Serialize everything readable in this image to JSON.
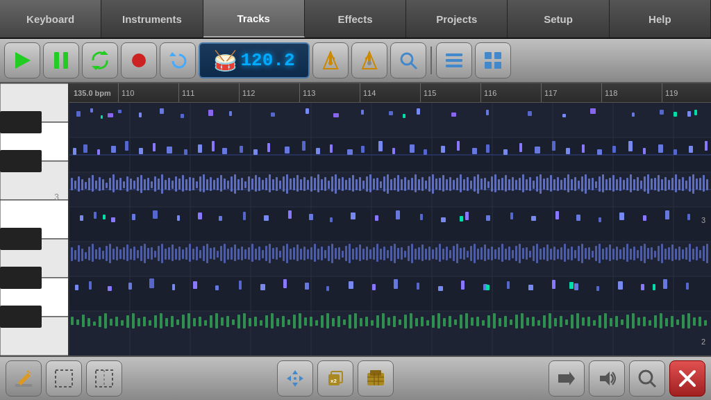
{
  "nav": {
    "tabs": [
      {
        "id": "keyboard",
        "label": "Keyboard",
        "active": false
      },
      {
        "id": "instruments",
        "label": "Instruments",
        "active": false
      },
      {
        "id": "tracks",
        "label": "Tracks",
        "active": true
      },
      {
        "id": "effects",
        "label": "Effects",
        "active": false
      },
      {
        "id": "projects",
        "label": "Projects",
        "active": false
      },
      {
        "id": "setup",
        "label": "Setup",
        "active": false
      },
      {
        "id": "help",
        "label": "Help",
        "active": false
      }
    ]
  },
  "toolbar": {
    "play_label": "▶",
    "pause_label": "⏸",
    "loop_label": "↺",
    "record_label": "⏺",
    "undo_label": "↩",
    "bpm_value": "120.2",
    "metronome1_label": "🎵",
    "metronome2_label": "🎵",
    "search_label": "🔍",
    "list_label": "≡",
    "grid_label": "⊞"
  },
  "timeline": {
    "bpm_label": "135.0 bpm",
    "markers": [
      "110",
      "111",
      "112",
      "113",
      "114",
      "115",
      "116",
      "117",
      "118",
      "119"
    ]
  },
  "bottom_bar": {
    "edit_label": "✏",
    "select_label": "⬚",
    "select2_label": "⬚",
    "move_label": "✛",
    "copy_label": "📋",
    "paste_label": "📋",
    "arrow_label": "→",
    "volume_label": "🔊",
    "search_label": "Q",
    "close_label": "✕"
  }
}
